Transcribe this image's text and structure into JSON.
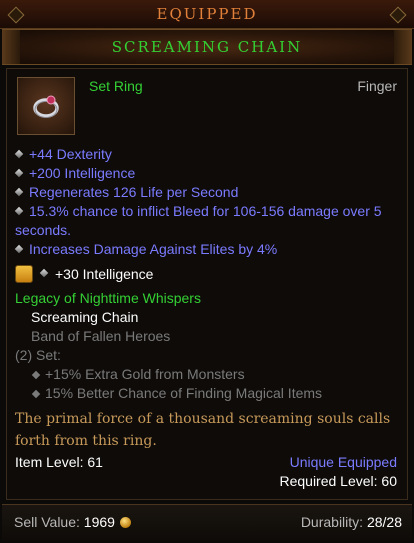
{
  "header": {
    "equipped_label": "EQUIPPED"
  },
  "item": {
    "name": "SCREAMING CHAIN",
    "type": "Set Ring",
    "slot": "Finger",
    "icon": "ring-icon"
  },
  "affixes": [
    "+44 Dexterity",
    "+200 Intelligence",
    "Regenerates 126 Life per Second",
    "15.3% chance to inflict Bleed for 106-156 damage over 5 seconds.",
    "Increases Damage Against Elites by 4%"
  ],
  "socket": {
    "gem_icon": "topaz-gem-icon",
    "bonus": "+30 Intelligence"
  },
  "set": {
    "name": "Legacy of Nighttime Whispers",
    "pieces": [
      "Screaming Chain",
      "Band of Fallen Heroes"
    ],
    "bonus_header": "(2) Set:",
    "bonuses": [
      "+15% Extra Gold from Monsters",
      "15% Better Chance of Finding Magical Items"
    ]
  },
  "flavor": "The primal force of a thousand screaming souls calls forth from this ring.",
  "stats": {
    "item_level": "Item Level: 61",
    "unique_equipped": "Unique Equipped",
    "required_level": "Required Level: 60"
  },
  "footer": {
    "sell_label": "Sell Value:",
    "sell_value": "1969",
    "durability_label": "Durability:",
    "durability_value": "28/28"
  },
  "colors": {
    "set_green": "#34d034",
    "magic_blue": "#7b7bff",
    "flavor_gold": "#c89a5a",
    "header_orange": "#e0803a"
  }
}
